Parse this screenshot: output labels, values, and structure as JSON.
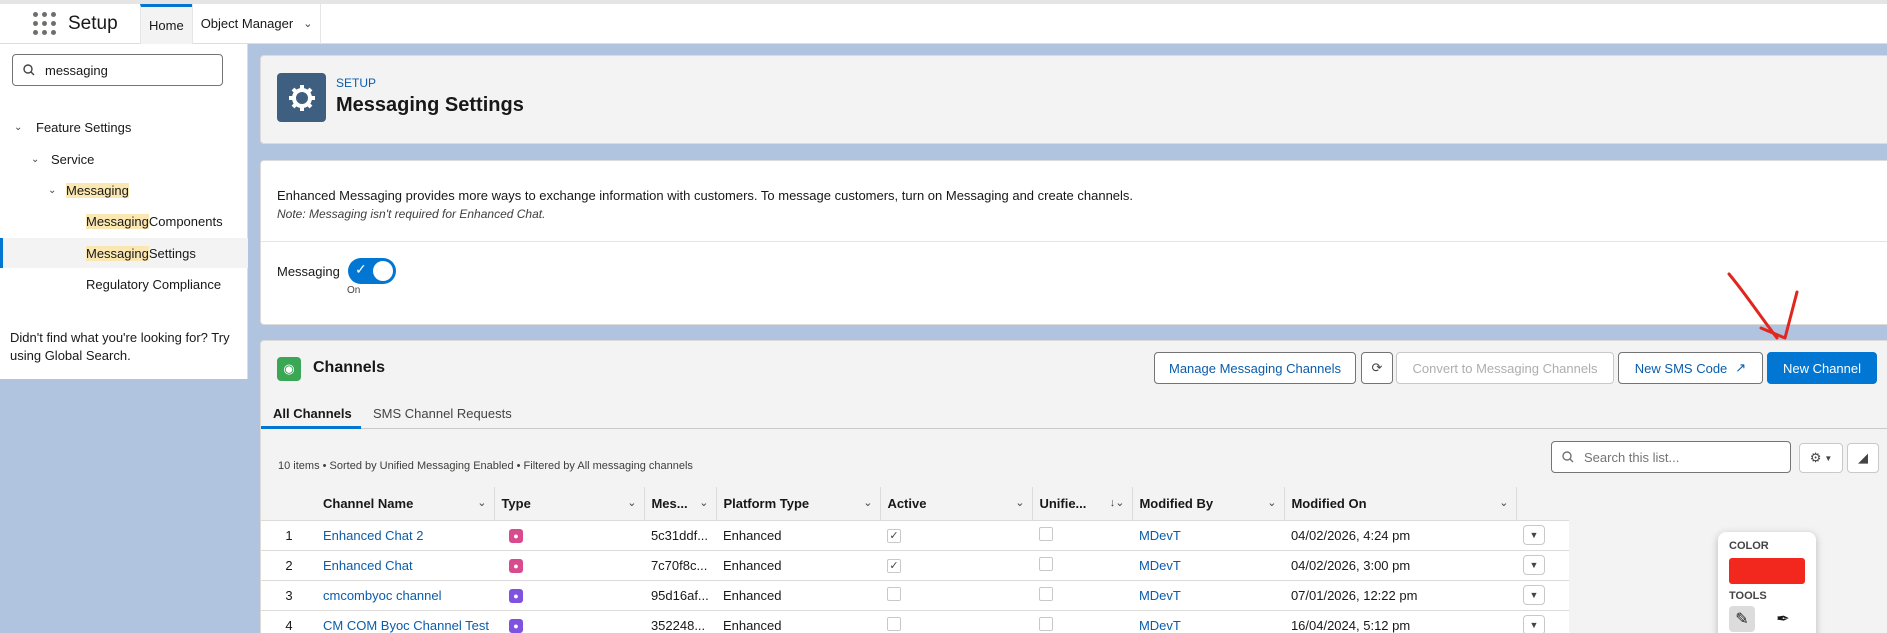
{
  "app": {
    "name": "Setup"
  },
  "nav": {
    "tabs": [
      {
        "label": "Home"
      },
      {
        "label": "Object Manager"
      }
    ]
  },
  "sidebar": {
    "search_value": "messaging",
    "tree": [
      {
        "label": "Feature Settings"
      },
      {
        "label": "Service"
      },
      {
        "label": "Messaging"
      },
      {
        "label_hl": "Messaging",
        "label_rest": " Components"
      },
      {
        "label_hl": "Messaging",
        "label_rest": " Settings"
      },
      {
        "label": "Regulatory Compliance"
      }
    ],
    "help_text": "Didn't find what you're looking for? Try using Global Search."
  },
  "header": {
    "eyebrow": "SETUP",
    "title": "Messaging Settings"
  },
  "info": {
    "line1": "Enhanced Messaging provides more ways to exchange information with customers. To message customers, turn on Messaging and create channels.",
    "line2": "Note: Messaging isn't required for Enhanced Chat.",
    "toggle_label": "Messaging",
    "toggle_state": "On"
  },
  "channels": {
    "title": "Channels",
    "buttons": {
      "manage": "Manage Messaging Channels",
      "convert": "Convert to Messaging Channels",
      "new_sms": "New SMS Code",
      "new_channel": "New Channel"
    },
    "tabs": [
      "All Channels",
      "SMS Channel Requests"
    ],
    "list_meta": "10 items • Sorted by Unified Messaging Enabled • Filtered by All messaging channels",
    "search_placeholder": "Search this list...",
    "columns": [
      "Channel Name",
      "Type",
      "Mes...",
      "Platform Type",
      "Active",
      "Unifie...",
      "Modified By",
      "Modified On"
    ],
    "rows": [
      {
        "n": "1",
        "name": "Enhanced Chat 2",
        "icon_color": "#d84b8f",
        "mes": "5c31ddf...",
        "platform": "Enhanced",
        "active": true,
        "unified": false,
        "by": "MDevT",
        "on": "04/02/2026, 4:24 pm"
      },
      {
        "n": "2",
        "name": "Enhanced Chat",
        "icon_color": "#d84b8f",
        "mes": "7c70f8c...",
        "platform": "Enhanced",
        "active": true,
        "unified": false,
        "by": "MDevT",
        "on": "04/02/2026, 3:00 pm"
      },
      {
        "n": "3",
        "name": "cmcombyoc channel",
        "icon_color": "#7f53e0",
        "mes": "95d16af...",
        "platform": "Enhanced",
        "active": false,
        "unified": false,
        "by": "MDevT",
        "on": "07/01/2026, 12:22 pm"
      },
      {
        "n": "4",
        "name": "CM COM Byoc Channel Test",
        "icon_color": "#7f53e0",
        "mes": "352248...",
        "platform": "Enhanced",
        "active": false,
        "unified": false,
        "by": "MDevT",
        "on": "16/04/2024, 5:12 pm"
      }
    ]
  },
  "annotation": {
    "color_label": "COLOR",
    "tools_label": "TOOLS",
    "color": "#f2281e"
  }
}
